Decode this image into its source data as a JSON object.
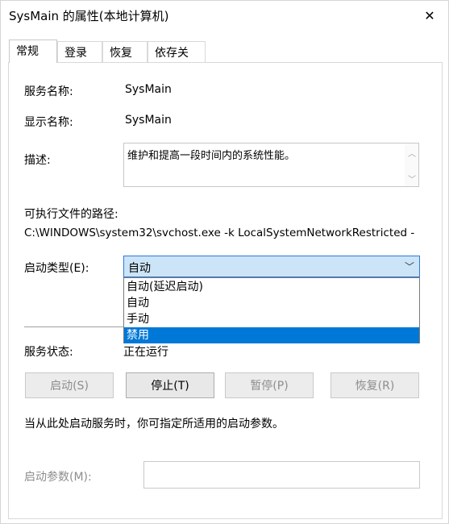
{
  "window": {
    "title": "SysMain 的属性(本地计算机)",
    "close_glyph": "✕"
  },
  "tabs": [
    {
      "label": "常规",
      "active": true
    },
    {
      "label": "登录",
      "active": false
    },
    {
      "label": "恢复",
      "active": false
    },
    {
      "label": "依存关系",
      "active": false
    }
  ],
  "general": {
    "service_name_label": "服务名称:",
    "service_name_value": "SysMain",
    "display_name_label": "显示名称:",
    "display_name_value": "SysMain",
    "description_label": "描述:",
    "description_value": "维护和提高一段时间内的系统性能。",
    "path_label": "可执行文件的路径:",
    "path_value": "C:\\WINDOWS\\system32\\svchost.exe -k LocalSystemNetworkRestricted -",
    "startup_type_label": "启动类型(E):",
    "startup_type_value": "自动",
    "startup_options": [
      "自动(延迟启动)",
      "自动",
      "手动",
      "禁用"
    ],
    "highlighted_option": "禁用",
    "service_status_label": "服务状态:",
    "service_status_value": "正在运行",
    "hint_text": "当从此处启动服务时，你可指定所适用的启动参数。",
    "start_params_label": "启动参数(M):",
    "start_params_value": ""
  },
  "buttons": {
    "start": "启动(S)",
    "stop": "停止(T)",
    "pause": "暂停(P)",
    "resume": "恢复(R)"
  },
  "icons": {
    "close": "close-icon",
    "chevron": "chevron-down-icon",
    "scroll_up": "scroll-up-icon",
    "scroll_down": "scroll-down-icon"
  },
  "colors": {
    "select_bg": "#cce4f7",
    "select_border": "#2f7ad6",
    "highlight": "#0078d7"
  }
}
